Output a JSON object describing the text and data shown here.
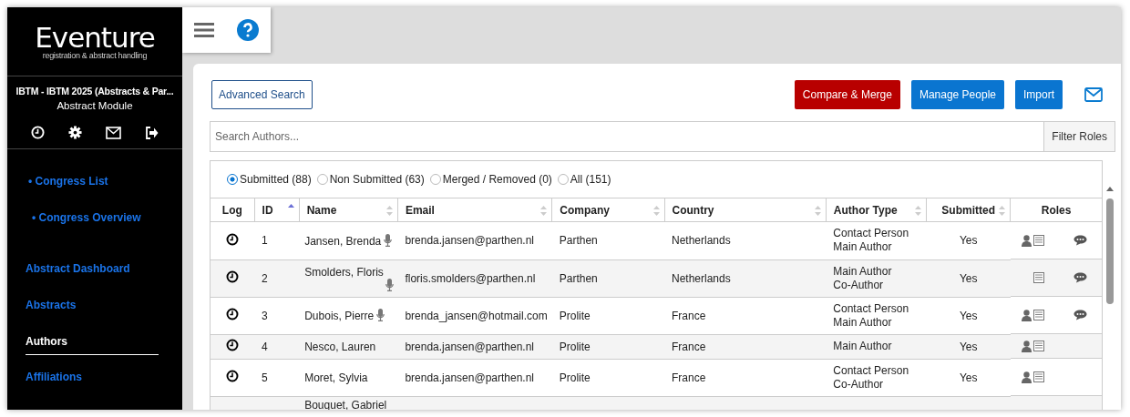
{
  "logo": {
    "title": "Eventure",
    "subtitle": "registration & abstract handling"
  },
  "event": {
    "name": "IBTM - IBTM 2025 (Abstracts & Par...",
    "module": "Abstract Module"
  },
  "sidebar": {
    "items": [
      {
        "label": "• Congress List",
        "kind": "sub",
        "selected": false
      },
      {
        "label": "• Congress Overview",
        "kind": "sub",
        "selected": false
      },
      {
        "label": "Abstract Dashboard",
        "kind": "main",
        "selected": false
      },
      {
        "label": "Abstracts",
        "kind": "main",
        "selected": false
      },
      {
        "label": "Authors",
        "kind": "main",
        "selected": true
      },
      {
        "label": "Affiliations",
        "kind": "main",
        "selected": false
      }
    ]
  },
  "toolbar": {
    "advanced_search": "Advanced Search",
    "buttons": [
      {
        "label": "Compare & Merge",
        "kind": "danger"
      },
      {
        "label": "Manage People",
        "kind": "primary"
      },
      {
        "label": "Import",
        "kind": "primary"
      }
    ]
  },
  "search": {
    "placeholder": "Search Authors...",
    "filter_button": "Filter Roles"
  },
  "filters": [
    {
      "label": "Submitted (88)",
      "selected": true
    },
    {
      "label": "Non Submitted (63)",
      "selected": false
    },
    {
      "label": "Merged / Removed (0)",
      "selected": false
    },
    {
      "label": "All (151)",
      "selected": false
    }
  ],
  "table": {
    "columns": [
      {
        "label": "Log",
        "kind": "plain"
      },
      {
        "label": "ID",
        "kind": "sorted"
      },
      {
        "label": "Name",
        "kind": "sortable"
      },
      {
        "label": "Email",
        "kind": "sortable"
      },
      {
        "label": "Company",
        "kind": "sortable"
      },
      {
        "label": "Country",
        "kind": "sortable"
      },
      {
        "label": "Author Type",
        "kind": "sortable"
      },
      {
        "label": "Submitted",
        "kind": "sortable"
      },
      {
        "label": "Roles",
        "kind": "plain"
      }
    ],
    "rows": [
      {
        "id": "1",
        "name": "Jansen, Brenda",
        "speaker": true,
        "email": "brenda.jansen@parthen.nl",
        "company": "Parthen",
        "country": "Netherlands",
        "author_type": [
          "Contact Person",
          "Main Author"
        ],
        "submitted": "Yes",
        "contact": true,
        "abstract": true,
        "comment": true
      },
      {
        "id": "2",
        "name": "Smolders, Floris",
        "speaker": true,
        "email": "floris.smolders@parthen.nl",
        "company": "Parthen",
        "country": "Netherlands",
        "author_type": [
          "Main Author",
          "Co-Author"
        ],
        "submitted": "Yes",
        "contact": false,
        "abstract": true,
        "comment": true
      },
      {
        "id": "3",
        "name": "Dubois, Pierre",
        "speaker": true,
        "email": "brenda_jansen@hotmail.com",
        "company": "Prolite",
        "country": "France",
        "author_type": [
          "Contact Person",
          "Main Author"
        ],
        "submitted": "Yes",
        "contact": true,
        "abstract": true,
        "comment": true
      },
      {
        "id": "4",
        "name": "Nesco, Lauren",
        "speaker": false,
        "email": "brenda.jansen@parthen.nl",
        "company": "Prolite",
        "country": "France",
        "author_type": [
          "Main Author"
        ],
        "submitted": "Yes",
        "contact": true,
        "abstract": true,
        "comment": false
      },
      {
        "id": "5",
        "name": "Moret, Sylvia",
        "speaker": false,
        "email": "brenda.jansen@parthen.nl",
        "company": "Prolite",
        "country": "France",
        "author_type": [
          "Contact Person",
          "Co-Author"
        ],
        "submitted": "Yes",
        "contact": true,
        "abstract": true,
        "comment": false
      },
      {
        "name": "Bouquet, Gabriel"
      }
    ]
  }
}
